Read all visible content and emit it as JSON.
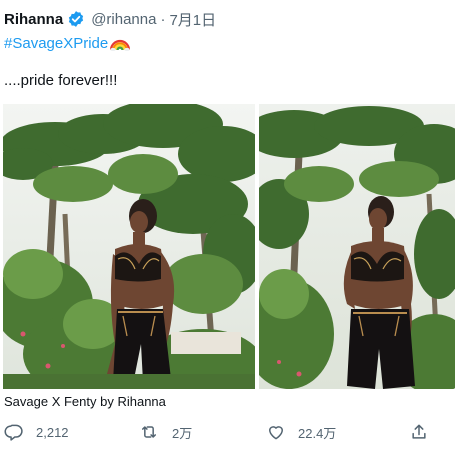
{
  "tweet": {
    "name": "Rihanna",
    "handle": "@rihanna",
    "separator": "·",
    "date": "7月1日",
    "hashtag": "#SavageXPride",
    "text": "....pride forever!!!",
    "media_caption": "Savage X Fenty by Rihanna"
  },
  "actions": {
    "replies": "2,212",
    "retweets": "2万",
    "likes": "22.4万"
  },
  "icons": {
    "verified": "verified-badge-icon",
    "rainbow": "rainbow-emoji-icon",
    "reply": "reply-icon",
    "retweet": "retweet-icon",
    "like": "heart-icon",
    "share": "share-icon"
  },
  "colors": {
    "link": "#1d9bf0",
    "muted": "#536471",
    "text": "#0f1419"
  }
}
